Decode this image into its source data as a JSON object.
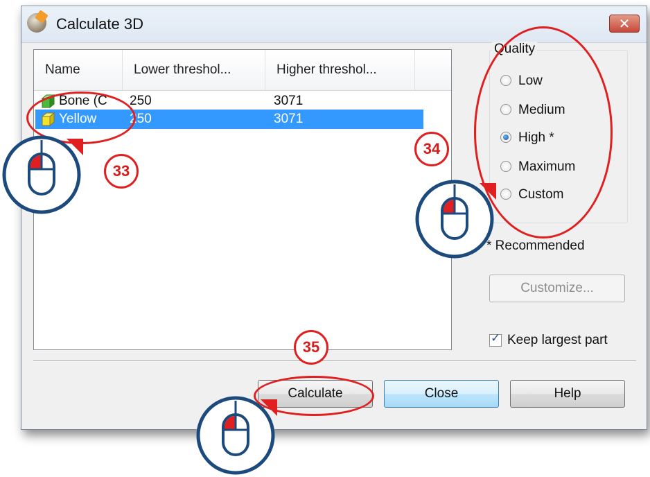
{
  "dialog": {
    "title": "Calculate 3D",
    "close_glyph": "✕"
  },
  "list": {
    "columns": [
      "Name",
      "Lower threshol...",
      "Higher threshol..."
    ],
    "rows": [
      {
        "name": "Bone (C",
        "lower": "250",
        "higher": "3071",
        "color": "#4cbb3c",
        "selected": false
      },
      {
        "name": "Yellow",
        "lower": "250",
        "higher": "3071",
        "color": "#f5e22a",
        "selected": true
      }
    ]
  },
  "quality": {
    "legend": "Quality",
    "options": [
      {
        "label": "Low",
        "checked": false
      },
      {
        "label": "Medium",
        "checked": false
      },
      {
        "label": "High *",
        "checked": true
      },
      {
        "label": "Maximum",
        "checked": false
      },
      {
        "label": "Custom",
        "checked": false
      }
    ]
  },
  "recommended_note": "* Recommended",
  "customize_button": "Customize...",
  "keep_largest": {
    "label": "Keep largest part",
    "checked": true
  },
  "buttons": {
    "calculate": "Calculate",
    "close": "Close",
    "help": "Help"
  },
  "annotations": {
    "step_33": "33",
    "step_34": "34",
    "step_35": "35",
    "annotation_color": "#e02020",
    "badge_color": "#1c4a7c"
  }
}
